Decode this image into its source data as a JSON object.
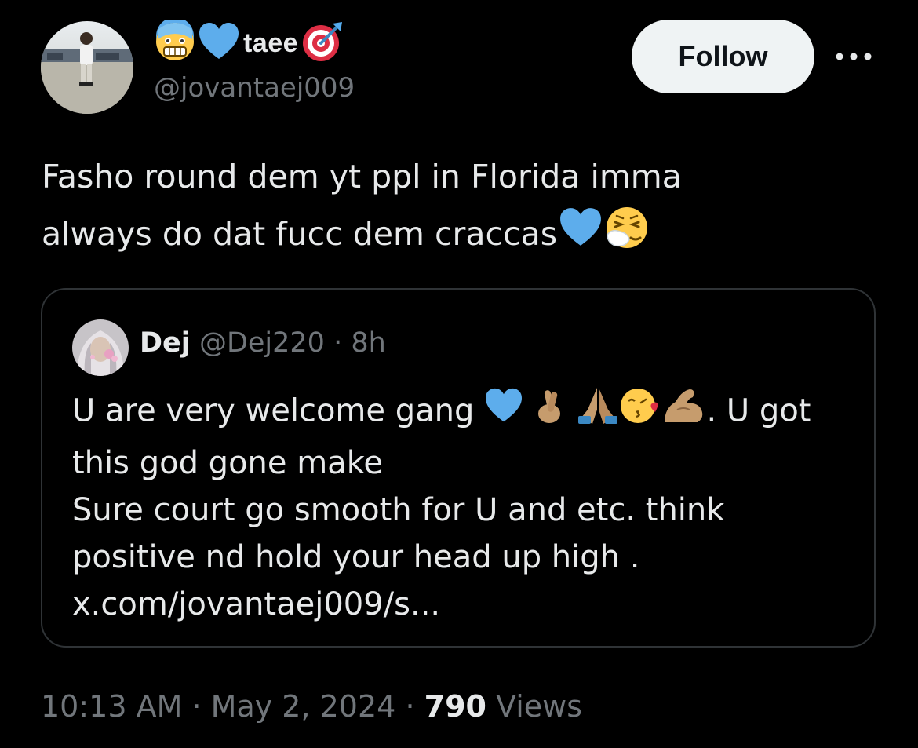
{
  "author": {
    "display_name": "taee",
    "handle": "@jovantaej009",
    "name_emojis": [
      "anxious-face-icon",
      "blue-heart-icon",
      "direct-hit-icon"
    ]
  },
  "follow_label": "Follow",
  "more_icon": "more-horizontal-icon",
  "tweet": {
    "text_line1": "Fasho round dem yt ppl in Florida imma",
    "text_line2": "always do dat fucc dem craccas",
    "trailing_emojis": [
      "blue-heart-icon",
      "sneezing-face-icon"
    ]
  },
  "quote": {
    "name": "Dej",
    "handle": "@Dej220",
    "separator": "·",
    "time": "8h",
    "line1_start": "U are very welcome gang",
    "line1_emojis": [
      "blue-heart-icon",
      "crossed-fingers-icon",
      "folded-hands-icon",
      "face-blowing-kiss-icon",
      "flexed-biceps-icon"
    ],
    "line1_end": ". U got",
    "line2": "this god gone make",
    "line3": "Sure court go smooth for U and etc. think",
    "line4": "positive nd hold your head up high .",
    "line5": "x.com/jovantaej009/s..."
  },
  "meta": {
    "time": "10:13 AM",
    "sep1": "·",
    "date": "May 2, 2024",
    "sep2": "·",
    "views_count": "790",
    "views_label": "Views"
  },
  "colors": {
    "background": "#000000",
    "primary_text": "#e7e9ea",
    "secondary_text": "#71767b",
    "border": "#2f3336",
    "follow_bg": "#eff3f4",
    "heart_blue": "#5dadec"
  }
}
